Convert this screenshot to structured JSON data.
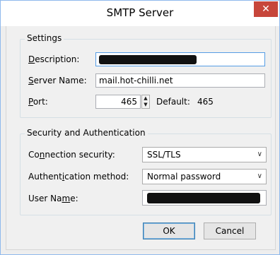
{
  "window": {
    "title": "SMTP Server",
    "close_glyph": "✕"
  },
  "settings": {
    "legend": "Settings",
    "description_label": {
      "key": "D",
      "rest": "escription:"
    },
    "description_value": "",
    "server_name_label": {
      "key": "S",
      "rest": "erver Name:"
    },
    "server_name_value": "mail.hot-chilli.net",
    "port_label": {
      "key": "P",
      "rest": "ort:"
    },
    "port_value": "465",
    "default_label": "Default:",
    "default_value": "465"
  },
  "security": {
    "legend": "Security and Authentication",
    "connection_label": {
      "pre": "Co",
      "key": "n",
      "post": "nection security:"
    },
    "connection_value": "SSL/TLS",
    "auth_label": {
      "pre": "Authent",
      "key": "i",
      "post": "cation method:"
    },
    "auth_value": "Normal password",
    "username_label": {
      "pre": "User Na",
      "key": "m",
      "post": "e:"
    },
    "username_value": ""
  },
  "buttons": {
    "ok": "OK",
    "cancel": "Cancel"
  },
  "icons": {
    "close": "close-icon",
    "dropdown": "chevron-down-icon",
    "spin_up": "chevron-up-icon",
    "spin_down": "chevron-down-icon"
  },
  "colors": {
    "window_border": "#8fb9ec",
    "close_button": "#c7463b",
    "focus_border": "#569de5",
    "default_button_border": "#3c7fb1"
  }
}
